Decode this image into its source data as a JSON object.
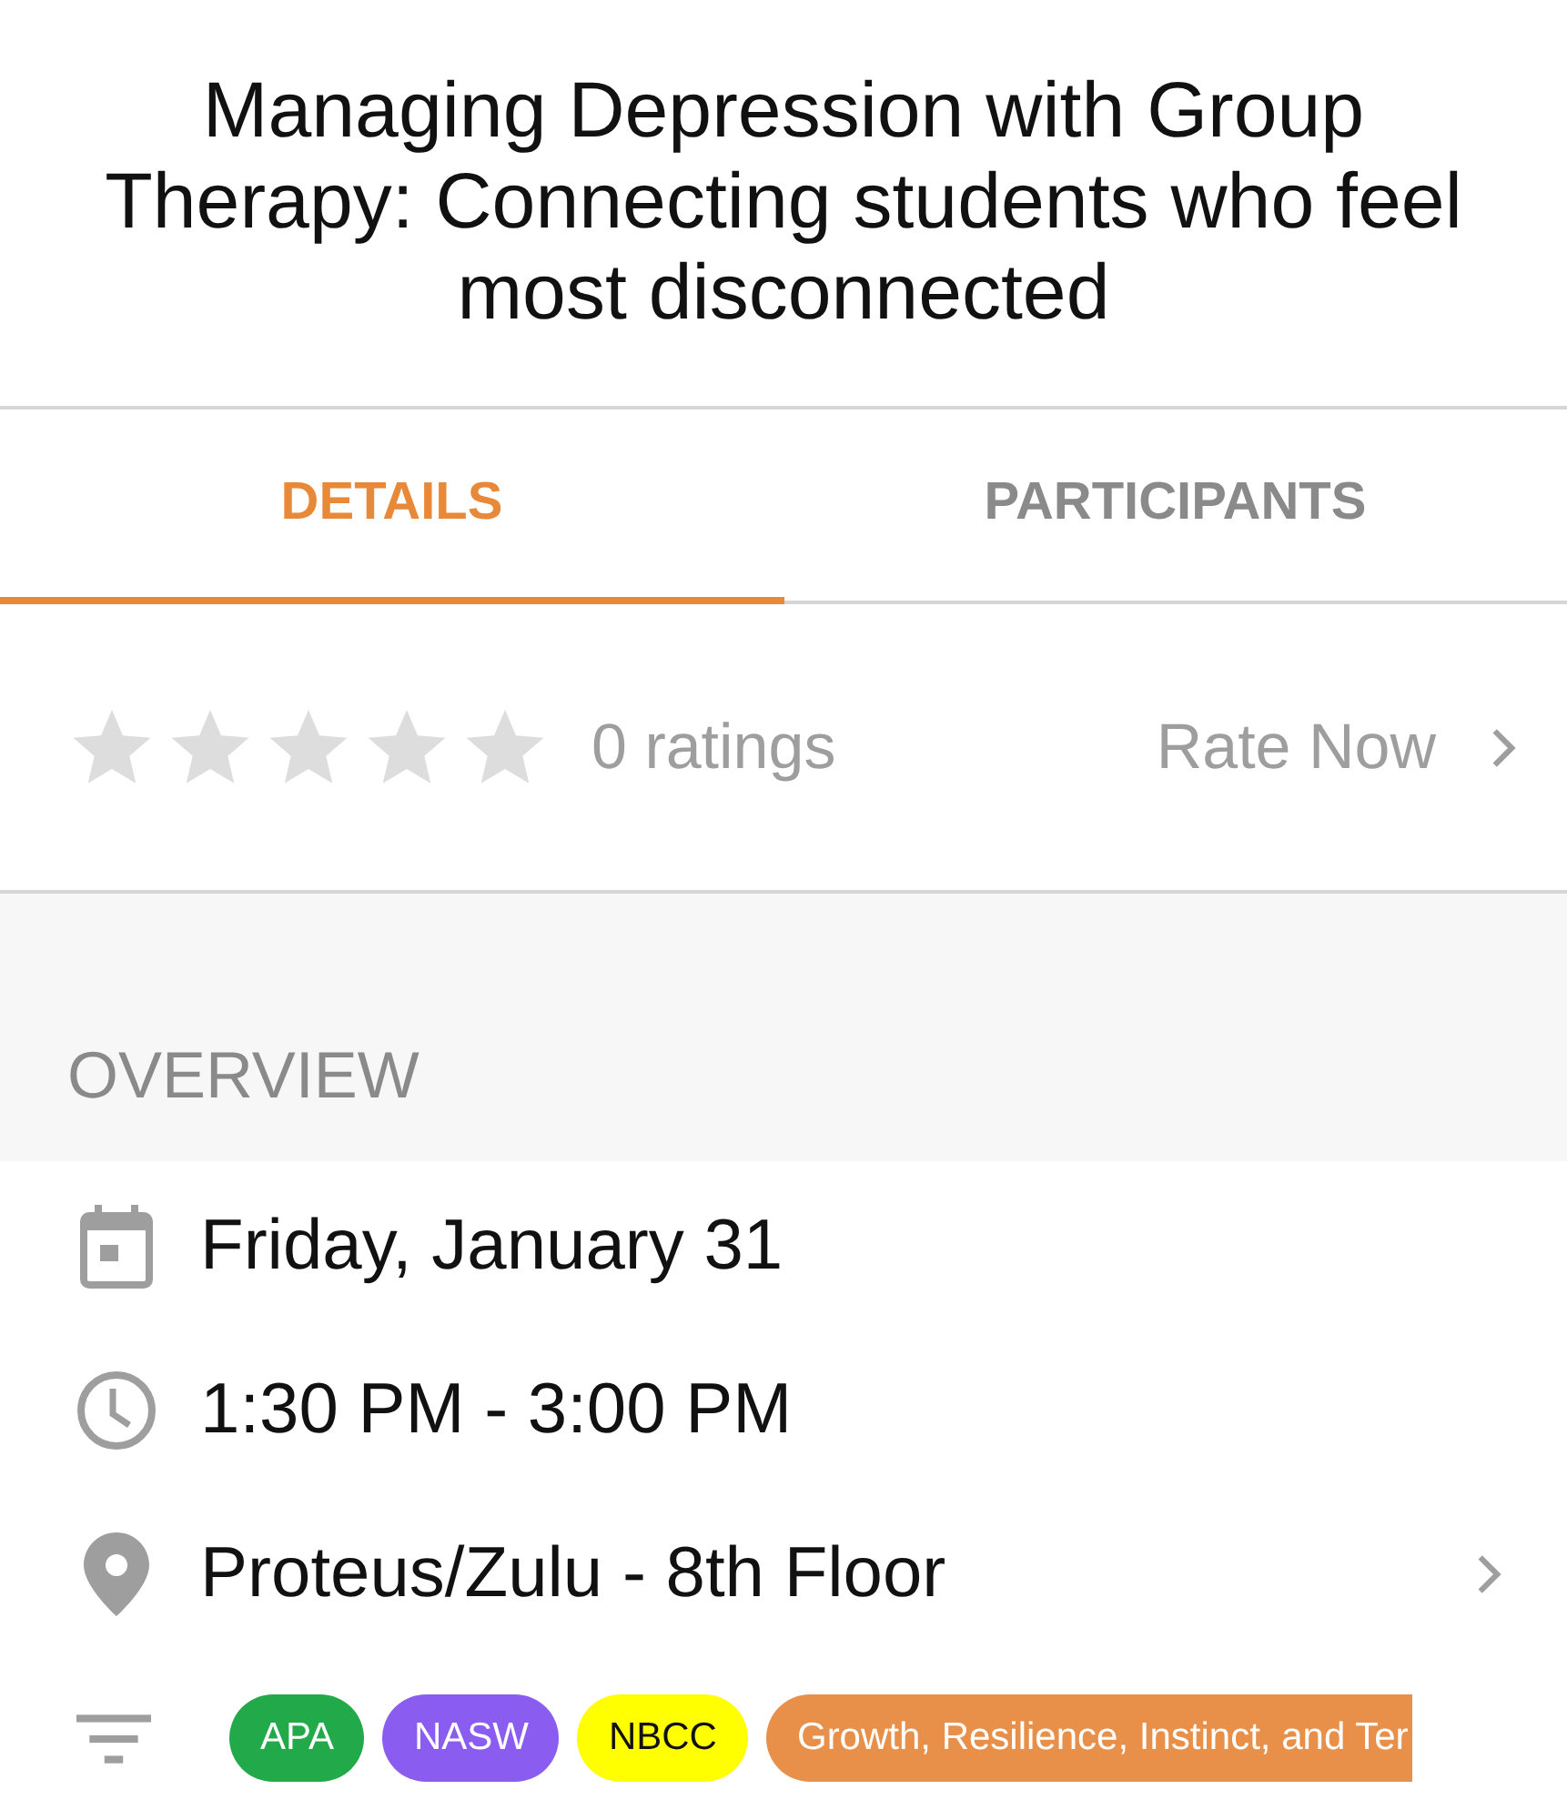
{
  "title": "Managing Depression with Group Therapy: Connecting students who feel most disconnected",
  "tabs": [
    {
      "label": "DETAILS",
      "selected": true
    },
    {
      "label": "PARTICIPANTS",
      "selected": false
    }
  ],
  "rating": {
    "stars": 0,
    "count": "0 ratings",
    "action": "Rate Now"
  },
  "overview": {
    "heading": "OVERVIEW",
    "items": [
      {
        "kind": "date",
        "text": "Friday, January 31",
        "navigable": false
      },
      {
        "kind": "time",
        "text": "1:30 PM - 3:00 PM",
        "navigable": false
      },
      {
        "kind": "location",
        "text": "Proteus/Zulu - 8th Floor",
        "navigable": true
      }
    ]
  },
  "tags": [
    {
      "label": "APA",
      "color": "#22a94a"
    },
    {
      "label": "NASW",
      "color": "#8b5cf0"
    },
    {
      "label": "NBCC",
      "color": "#ffff00"
    },
    {
      "label": "Growth, Resilience, Instinct, and Ter",
      "color": "#e8904a"
    }
  ]
}
